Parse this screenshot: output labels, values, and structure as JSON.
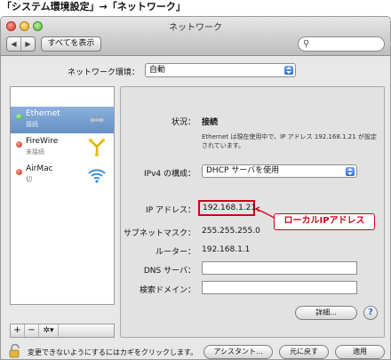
{
  "caption": "「システム環境設定」→「ネットワーク」",
  "window": {
    "title": "ネットワーク"
  },
  "toolbar": {
    "back": "◀",
    "forward": "▶",
    "show_all": "すべてを表示",
    "search_placeholder": ""
  },
  "location": {
    "label": "ネットワーク環境：",
    "value": "自動"
  },
  "services": [
    {
      "name": "Ethernet",
      "status": "接続",
      "status_color": "green",
      "icon": "ethernet-icon",
      "selected": true
    },
    {
      "name": "FireWire",
      "status": "未接続",
      "status_color": "red",
      "icon": "firewire-icon",
      "selected": false
    },
    {
      "name": "AirMac",
      "status": "切",
      "status_color": "red",
      "icon": "wifi-icon",
      "selected": false
    }
  ],
  "sidebar_tools": {
    "add": "+",
    "remove": "−",
    "gear": "✲▾"
  },
  "detail": {
    "status_label": "状況：",
    "status_value": "接続",
    "status_desc": "Ethernet は現在使用中で、IP アドレス 192.168.1.21 が設定されています。",
    "ipv4_label": "IPv4 の構成：",
    "ipv4_value": "DHCP サーバを使用",
    "ip_label": "IP アドレス：",
    "ip_value": "192.168.1.21",
    "subnet_label": "サブネットマスク：",
    "subnet_value": "255.255.255.0",
    "router_label": "ルーター：",
    "router_value": "192.168.1.1",
    "dns_label": "DNS サーバ：",
    "dns_value": "",
    "search_domain_label": "検索ドメイン：",
    "search_domain_value": "",
    "advanced_button": "詳細...",
    "help": "?"
  },
  "annotation": {
    "text": "ローカルIPアドレス",
    "color": "#d0021b"
  },
  "footer": {
    "lock_text": "変更できないようにするにはカギをクリックします。",
    "assist_button": "アシスタント...",
    "revert_button": "元に戻す",
    "apply_button": "適用"
  }
}
